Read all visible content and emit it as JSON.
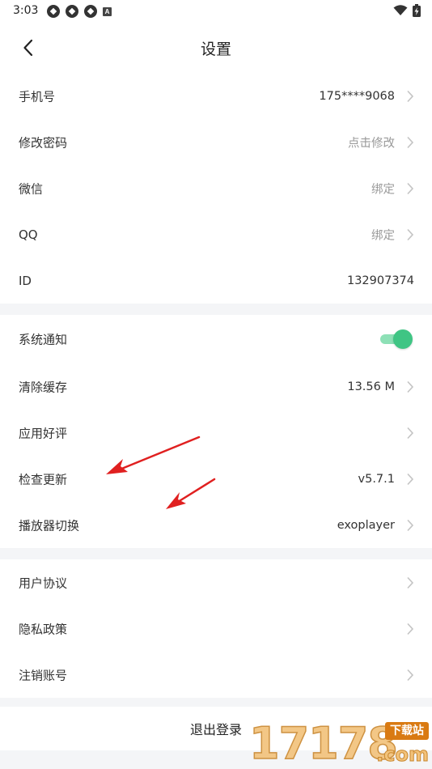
{
  "status_bar": {
    "time": "3:03",
    "icon_box_letter": "A"
  },
  "nav": {
    "title": "设置"
  },
  "account_section": {
    "rows": [
      {
        "label": "手机号",
        "value": "175****9068"
      },
      {
        "label": "修改密码",
        "value": "点击修改"
      },
      {
        "label": "微信",
        "value": "绑定"
      },
      {
        "label": "QQ",
        "value": "绑定"
      },
      {
        "label": "ID",
        "value": "132907374"
      }
    ]
  },
  "app_section": {
    "notification": {
      "label": "系统通知",
      "enabled": true
    },
    "rows": [
      {
        "label": "清除缓存",
        "value": "13.56 M"
      },
      {
        "label": "应用好评",
        "value": ""
      },
      {
        "label": "检查更新",
        "value": "v5.7.1"
      },
      {
        "label": "播放器切换",
        "value": "exoplayer"
      }
    ]
  },
  "legal_section": {
    "rows": [
      {
        "label": "用户协议"
      },
      {
        "label": "隐私政策"
      },
      {
        "label": "注销账号"
      }
    ]
  },
  "logout": {
    "label": "退出登录"
  },
  "watermark": {
    "digits": "17178",
    "badge": "下载站",
    "suffix": ".com"
  },
  "colors": {
    "accent": "#3fc584",
    "accent_track": "#8de0b6",
    "divider": "#f4f5f7",
    "muted_text": "#9a9a9a",
    "annotation_arrow": "#e02020"
  }
}
